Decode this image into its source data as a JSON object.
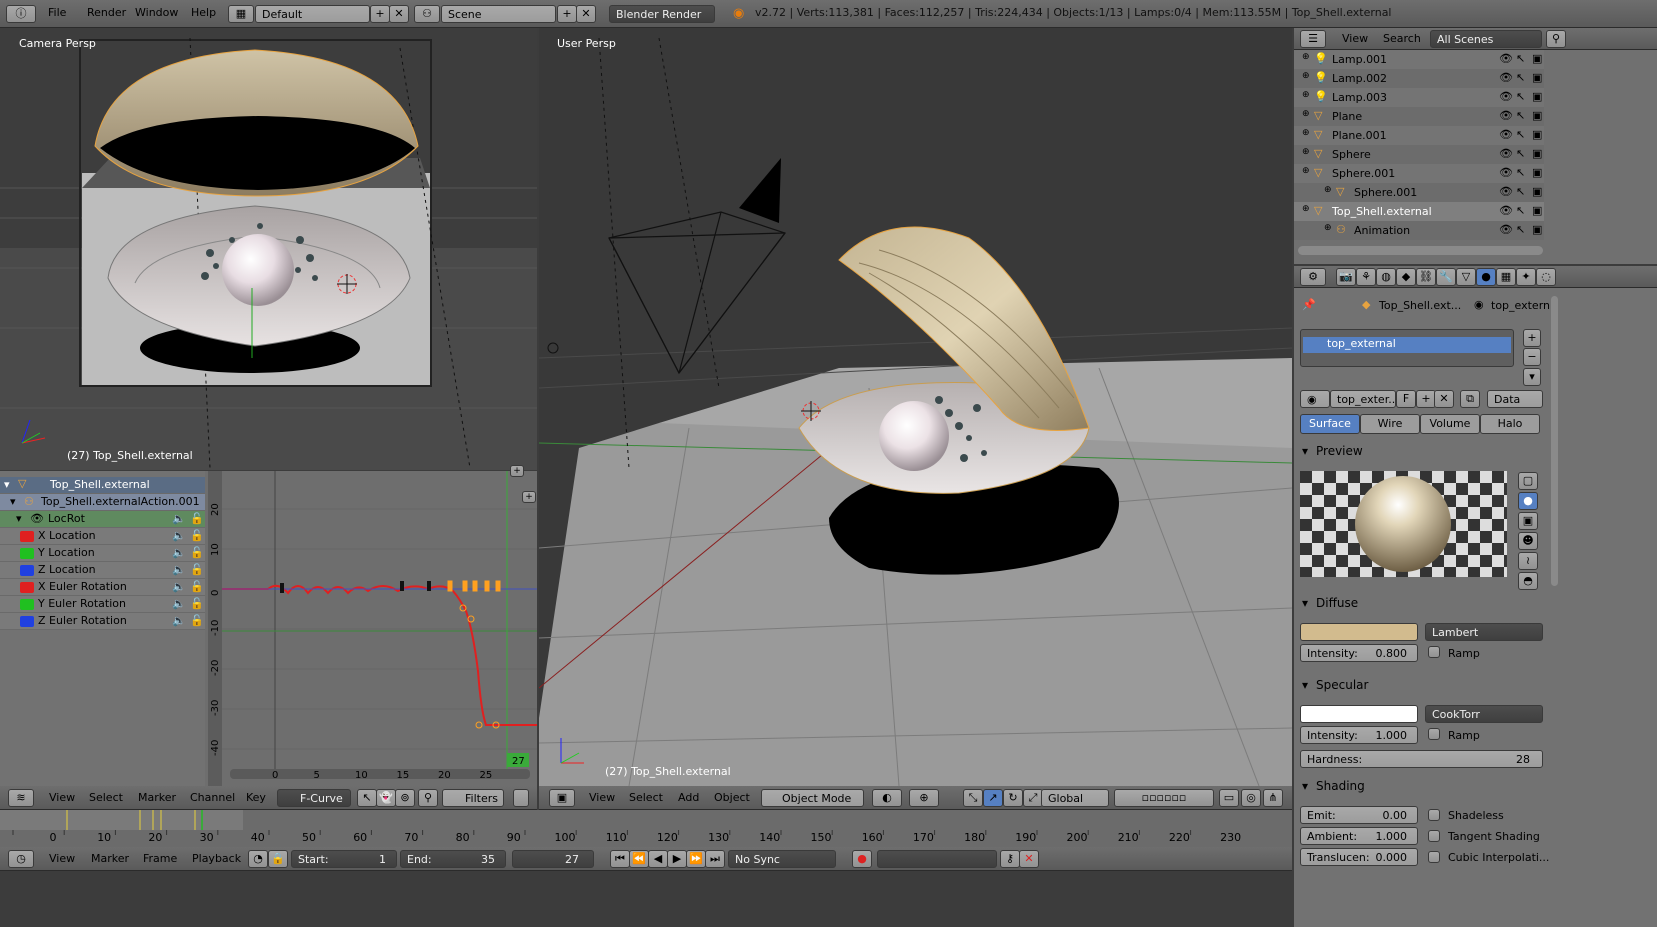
{
  "topbar": {
    "menus": [
      "File",
      "Render",
      "Window",
      "Help"
    ],
    "layout": "Default",
    "scene": "Scene",
    "engine": "Blender Render",
    "stats": "v2.72 | Verts:113,381 | Faces:112,257 | Tris:224,434 | Objects:1/13 | Lamps:0/4 | Mem:113.55M | Top_Shell.external"
  },
  "camera_view": {
    "label": "Camera Persp",
    "object_label": "(27) Top_Shell.external"
  },
  "user_view": {
    "label": "User Persp",
    "object_label": "(27) Top_Shell.external",
    "header": {
      "menus": [
        "View",
        "Select",
        "Add",
        "Object"
      ],
      "mode": "Object Mode",
      "orientation": "Global"
    }
  },
  "outliner": {
    "menus": [
      "View",
      "Search"
    ],
    "filter": "All Scenes",
    "items": [
      "Lamp.001",
      "Lamp.002",
      "Lamp.003",
      "Plane",
      "Plane.001",
      "Sphere",
      "Sphere.001",
      "Sphere.001",
      "Top_Shell.external",
      "Animation"
    ]
  },
  "properties": {
    "breadcrumb": [
      "Top_Shell.ext...",
      "top_extern"
    ],
    "material_slot": "top_external",
    "material_name": "top_exter...",
    "material_f": "F",
    "data_btn": "Data",
    "tabs": [
      "Surface",
      "Wire",
      "Volume",
      "Halo"
    ],
    "preview_label": "Preview",
    "diffuse": {
      "title": "Diffuse",
      "shader": "Lambert",
      "intensity_label": "Intensity:",
      "intensity": "0.800",
      "ramp": "Ramp",
      "color": "#d2bb8e"
    },
    "specular": {
      "title": "Specular",
      "shader": "CookTorr",
      "intensity_label": "Intensity:",
      "intensity": "1.000",
      "ramp": "Ramp",
      "hardness_label": "Hardness:",
      "hardness": "28"
    },
    "shading": {
      "title": "Shading",
      "emit_label": "Emit:",
      "emit": "0.00",
      "ambient_label": "Ambient:",
      "ambient": "1.000",
      "translucency_label": "Translucen:",
      "translucency": "0.000",
      "shadeless": "Shadeless",
      "tangent": "Tangent Shading",
      "cubic": "Cubic Interpolati..."
    }
  },
  "graph_editor": {
    "object": "Top_Shell.external",
    "action": "Top_Shell.externalAction.001",
    "group": "LocRot",
    "channels": [
      {
        "name": "X Location",
        "color": "#e02020"
      },
      {
        "name": "Y Location",
        "color": "#20c020"
      },
      {
        "name": "Z Location",
        "color": "#2040e0"
      },
      {
        "name": "X Euler Rotation",
        "color": "#e02020"
      },
      {
        "name": "Y Euler Rotation",
        "color": "#20c020"
      },
      {
        "name": "Z Euler Rotation",
        "color": "#2040e0"
      }
    ],
    "y_ticks": [
      "20",
      "10",
      "0",
      "-10",
      "-20",
      "-30",
      "-40"
    ],
    "x_ticks": [
      "0",
      "5",
      "10",
      "15",
      "20",
      "25"
    ],
    "current_frame": "27",
    "header": {
      "menus": [
        "View",
        "Select",
        "Marker",
        "Channel",
        "Key"
      ],
      "mode": "F-Curve",
      "filters": "Filters"
    }
  },
  "timeline": {
    "ticks": [
      "0",
      "10",
      "20",
      "30",
      "40",
      "50",
      "60",
      "70",
      "80",
      "90",
      "100",
      "110",
      "120",
      "130",
      "140",
      "150",
      "160",
      "170",
      "180",
      "190",
      "200",
      "210",
      "220",
      "230"
    ],
    "menus": [
      "View",
      "Marker",
      "Frame",
      "Playback"
    ],
    "start_label": "Start:",
    "start": "1",
    "end_label": "End:",
    "end": "35",
    "current": "27",
    "sync": "No Sync"
  }
}
